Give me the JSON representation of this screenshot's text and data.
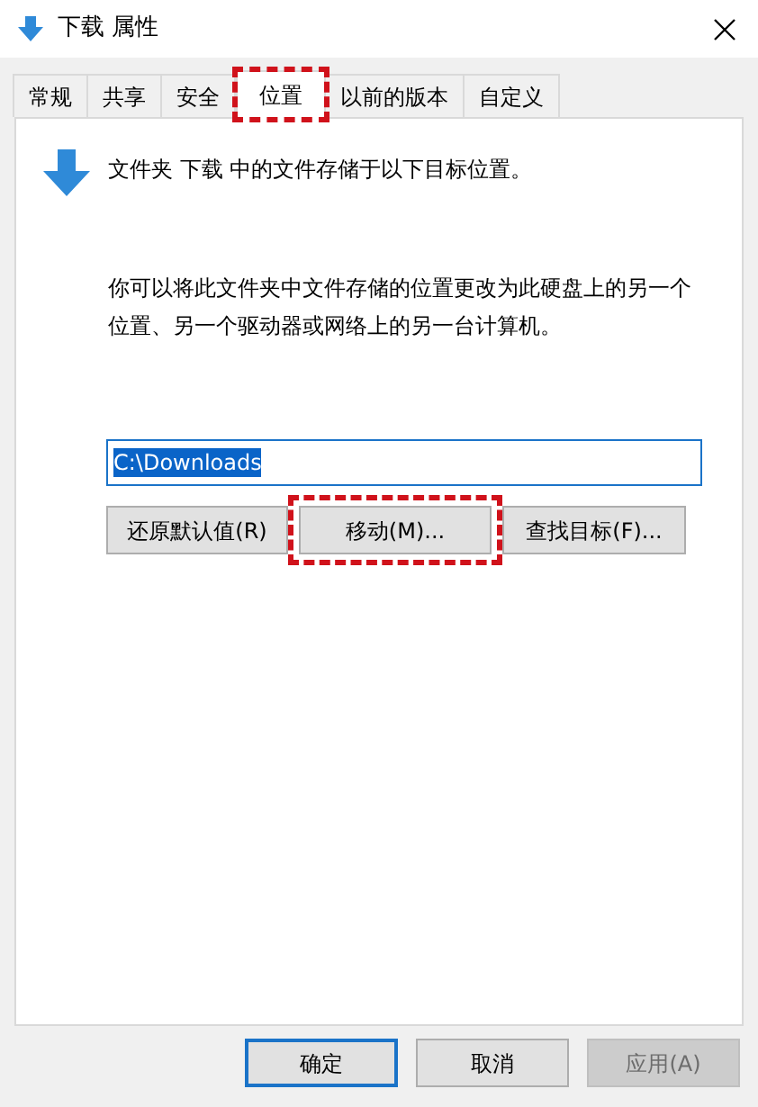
{
  "window": {
    "title": "下载 属性"
  },
  "tabs": [
    {
      "label": "常规",
      "selected": false,
      "highlighted": false
    },
    {
      "label": "共享",
      "selected": false,
      "highlighted": false
    },
    {
      "label": "安全",
      "selected": false,
      "highlighted": false
    },
    {
      "label": "位置",
      "selected": true,
      "highlighted": true
    },
    {
      "label": "以前的版本",
      "selected": false,
      "highlighted": false
    },
    {
      "label": "自定义",
      "selected": false,
      "highlighted": false
    }
  ],
  "location": {
    "summary": "文件夹 下载 中的文件存储于以下目标位置。",
    "description": "你可以将此文件夹中文件存储的位置更改为此硬盘上的另一个位置、另一个驱动器或网络上的另一台计算机。",
    "path": {
      "value": "C:\\Downloads",
      "selected": true
    },
    "buttons": [
      {
        "label": "还原默认值(R)",
        "highlighted": false
      },
      {
        "label": "移动(M)...",
        "highlighted": true
      },
      {
        "label": "查找目标(F)...",
        "highlighted": false
      }
    ]
  },
  "footer_buttons": [
    {
      "label": "确定",
      "default": true,
      "disabled": false
    },
    {
      "label": "取消",
      "default": false,
      "disabled": false
    },
    {
      "label": "应用(A)",
      "default": false,
      "disabled": true
    }
  ]
}
